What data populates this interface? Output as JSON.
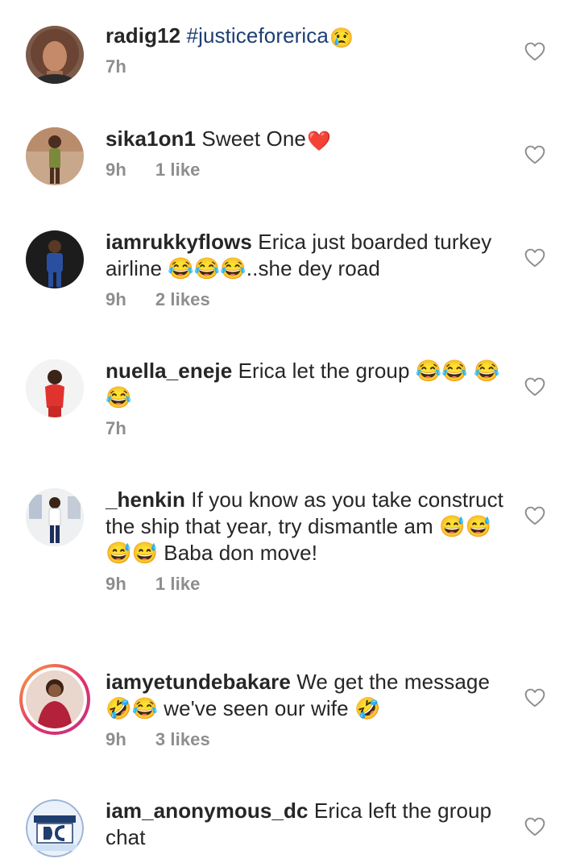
{
  "comments": [
    {
      "username": "radig12",
      "hashtag": "#justiceforerica",
      "text": "",
      "emoji": "😢",
      "time": "7h",
      "likes": ""
    },
    {
      "username": "sika1on1",
      "text": "Sweet One",
      "emoji": "❤️",
      "time": "9h",
      "likes": "1 like"
    },
    {
      "username": "iamrukkyflows",
      "text": "Erica just boarded turkey airline 😂😂😂..she dey road",
      "time": "9h",
      "likes": "2 likes"
    },
    {
      "username": "nuella_eneje",
      "text": "Erica let the group 😂😂 😂😂",
      "time": "7h",
      "likes": ""
    },
    {
      "username": "_henkin",
      "text": "If you know as you take construct the ship that year, try dismantle am 😅😅😅😅 Baba don move!",
      "time": "9h",
      "likes": "1 like"
    },
    {
      "username": "iamyetundebakare",
      "text": "We get the message 🤣😂 we've seen our wife 🤣",
      "time": "9h",
      "likes": "3 likes"
    },
    {
      "username": "iam_anonymous_dc",
      "text": "Erica left the group chat",
      "time": "",
      "likes": ""
    }
  ],
  "icons": {
    "like": "heart-outline-icon"
  },
  "colors": {
    "text": "#262626",
    "meta": "#8e8e8e",
    "hashtag": "#1d3f73"
  }
}
